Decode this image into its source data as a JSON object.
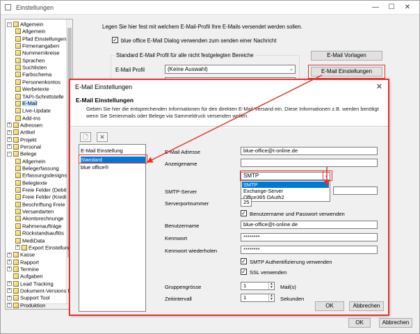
{
  "window": {
    "title": "Einstellungen",
    "minimize": "—",
    "maximize": "☐",
    "close": "✕"
  },
  "tree": {
    "items": [
      {
        "label": "Allgemein",
        "level": 0,
        "expander": "−"
      },
      {
        "label": "Allgemein",
        "level": 1
      },
      {
        "label": "Pfad Einstellungen",
        "level": 1
      },
      {
        "label": "Firmenangaben",
        "level": 1
      },
      {
        "label": "Nummernkreise",
        "level": 1
      },
      {
        "label": "Sprachen",
        "level": 1
      },
      {
        "label": "Suchlisten",
        "level": 1
      },
      {
        "label": "Farbschema",
        "level": 1
      },
      {
        "label": "Personenkontos",
        "level": 1
      },
      {
        "label": "Werbetexte",
        "level": 1
      },
      {
        "label": "TAPI-Schnittstelle",
        "level": 1
      },
      {
        "label": "E-Mail",
        "level": 1,
        "selected": true
      },
      {
        "label": "Live-Update",
        "level": 1
      },
      {
        "label": "Add-Ins",
        "level": 1
      },
      {
        "label": "Adressen",
        "level": 0,
        "expander": "+"
      },
      {
        "label": "Artikel",
        "level": 0,
        "expander": "+"
      },
      {
        "label": "Projekt",
        "level": 0,
        "expander": "+"
      },
      {
        "label": "Personal",
        "level": 0,
        "expander": "+"
      },
      {
        "label": "Belege",
        "level": 0,
        "expander": "−"
      },
      {
        "label": "Allgemein",
        "level": 1
      },
      {
        "label": "Belegerfassung",
        "level": 1
      },
      {
        "label": "Erfassungsdesigns",
        "level": 1
      },
      {
        "label": "Belegtexte",
        "level": 1
      },
      {
        "label": "Freie Felder (Debit",
        "level": 1
      },
      {
        "label": "Freie Felder (Kredi",
        "level": 1
      },
      {
        "label": "Beschriftung Freie",
        "level": 1
      },
      {
        "label": "Versandarten",
        "level": 1
      },
      {
        "label": "Akontorechnunge",
        "level": 1
      },
      {
        "label": "Rahmenaufträge",
        "level": 1
      },
      {
        "label": "Rückstandsauflös",
        "level": 1
      },
      {
        "label": "MediData",
        "level": 1
      },
      {
        "label": "Export Einstellung",
        "level": 1,
        "expander": "+"
      },
      {
        "label": "Kasse",
        "level": 0,
        "expander": "+"
      },
      {
        "label": "Rapport",
        "level": 0,
        "expander": "+"
      },
      {
        "label": "Termine",
        "level": 0,
        "expander": "+"
      },
      {
        "label": "Aufgaben",
        "level": 0
      },
      {
        "label": "Lead Tracking",
        "level": 0,
        "expander": "+"
      },
      {
        "label": "Dokument-Versions M",
        "level": 0,
        "expander": "+"
      },
      {
        "label": "Support Tool",
        "level": 0,
        "expander": "+"
      },
      {
        "label": "Produktion",
        "level": 0,
        "expander": "+"
      }
    ]
  },
  "main": {
    "intro": "Legen Sie hier fest mit welchem E-Mail-Profil Ihre E-Mails versendet werden sollen.",
    "dialog_checkbox_label": "blue office E-Mail Dialog verwenden zum senden einer Nachricht",
    "dialog_checkbox_mark": "✓",
    "group_title": "Standard E-Mail Profil für alle nicht festgelegten Bereiche",
    "profile_label": "E-Mail Profil",
    "profile_value": "(Keine Auswahl)",
    "btn_templates": "E-Mail Vorlagen",
    "btn_settings": "E-Mail Einstellungen",
    "ok": "OK",
    "cancel": "Abbrechen"
  },
  "dialog": {
    "title": "E-Mail Einstellungen",
    "close": "✕",
    "header": "E-Mail Einstellungen",
    "description": "Geben Sie hier die entsprechenden Informationen für den direkten E-Mail Versand ein. Diese Informationen z.B. werden benötigt wenn Sie Serienmails oder Belege via Sammeldruck versenden wollen.",
    "new_icon": "🗋",
    "delete_icon": "✕",
    "list": {
      "items": [
        "E-Mail Einstellung",
        "Standard",
        "blue office®"
      ]
    },
    "fields": {
      "email_label": "E-Mail Adresse",
      "email_value": "blue-office@t-online.de",
      "display_label": "Anzeigename",
      "display_value": "",
      "type_value": "SMTP",
      "type_options": [
        "SMTP",
        "Exchange-Server",
        "Office365 OAuth2"
      ],
      "smtp_label": "SMTP-Server",
      "smtp_value": "",
      "port_label": "Serverportnummer",
      "port_value": "25",
      "use_auth_label": "Benutzername und Passwort verwenden",
      "user_label": "Benutzername",
      "user_value": "blue-office@t-online.de",
      "pw_label": "Kennwort",
      "pw_value": "********",
      "pw2_label": "Kennwort wiederholen",
      "pw2_value": "********",
      "smtp_auth_label": "SMTP Authentifizierung verwenden",
      "ssl_label": "SSL verwenden",
      "group_label": "Gruppengrösse",
      "group_value": "1",
      "group_unit": "Mail(s)",
      "interval_label": "Zeitintervall",
      "interval_value": "1",
      "interval_unit": "Sekunden",
      "check_mark": "✓",
      "spin_up": "▲",
      "spin_down": "▼"
    },
    "ok": "OK",
    "cancel": "Abbrechen"
  },
  "colors": {
    "accent_red": "#e5322d",
    "selection_blue": "#0078d7"
  }
}
